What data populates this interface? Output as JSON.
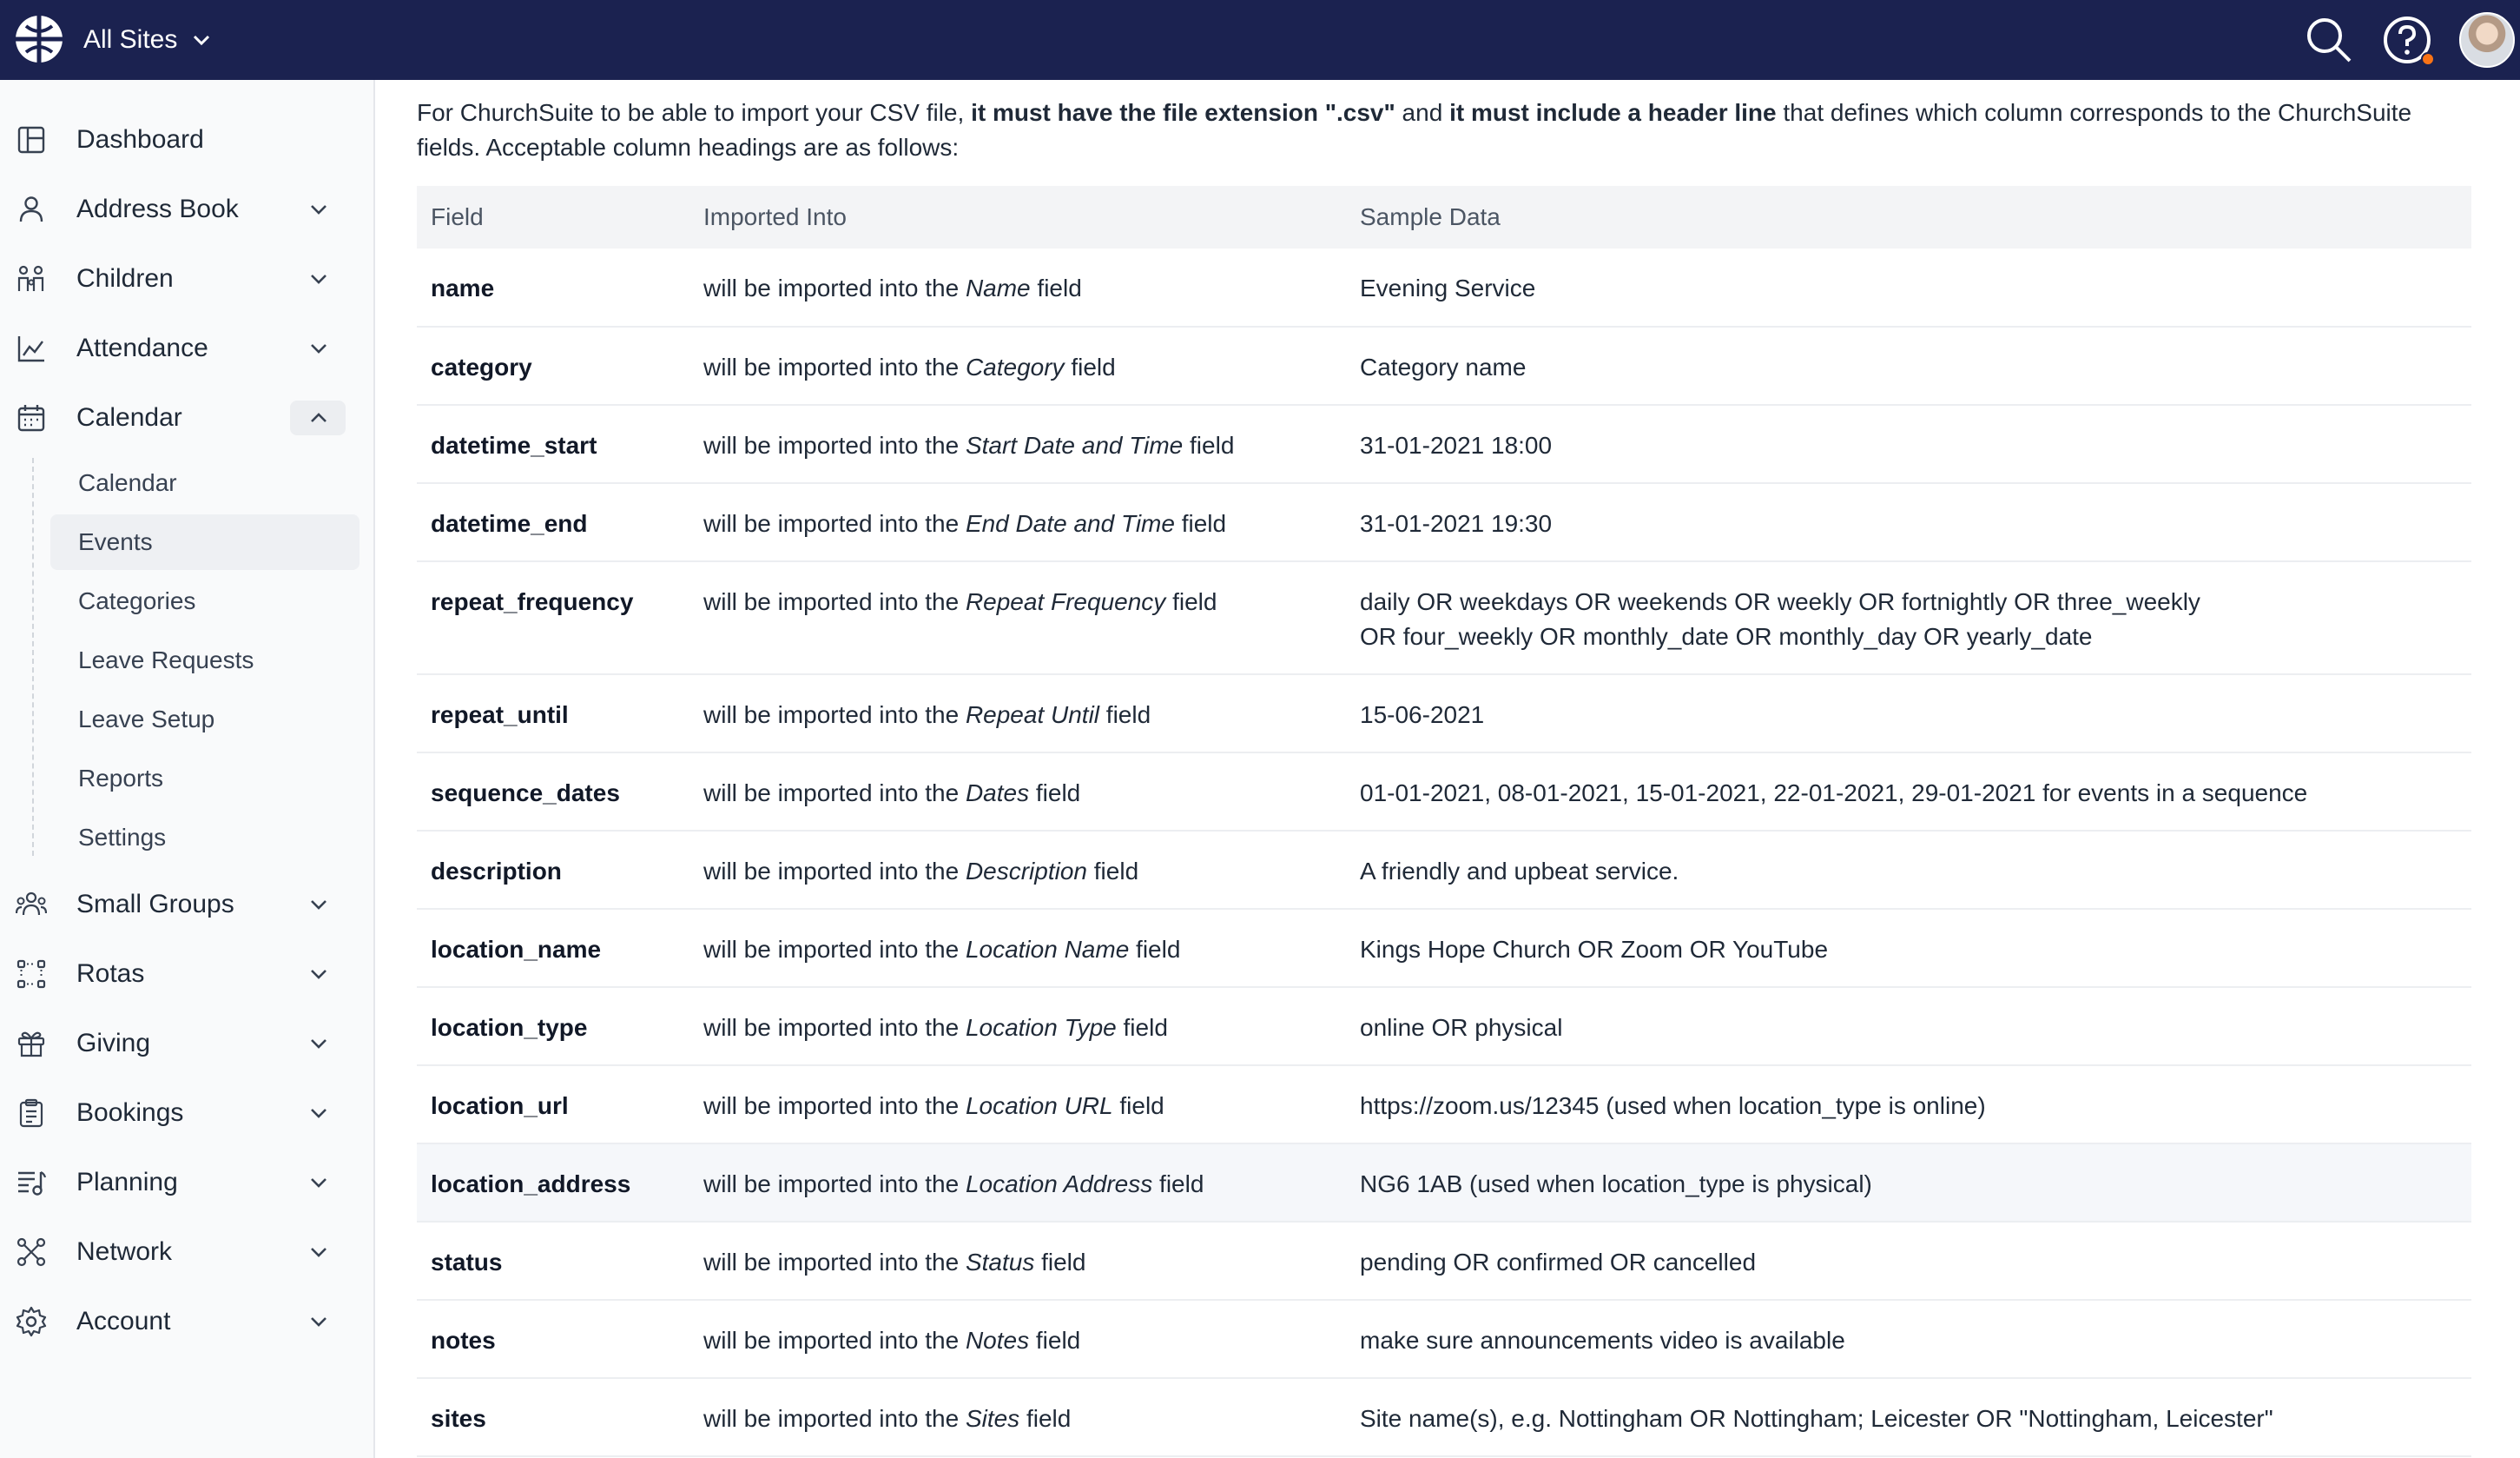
{
  "header": {
    "site_selector": "All Sites"
  },
  "sidebar": {
    "items": [
      {
        "label": "Dashboard",
        "icon": "dashboard-icon",
        "has_chevron": false
      },
      {
        "label": "Address Book",
        "icon": "person-icon",
        "has_chevron": true
      },
      {
        "label": "Children",
        "icon": "family-icon",
        "has_chevron": true
      },
      {
        "label": "Attendance",
        "icon": "chart-icon",
        "has_chevron": true
      },
      {
        "label": "Calendar",
        "icon": "calendar-icon",
        "has_chevron": true,
        "expanded": true
      },
      {
        "label": "Small Groups",
        "icon": "groups-icon",
        "has_chevron": true
      },
      {
        "label": "Rotas",
        "icon": "rotas-icon",
        "has_chevron": true
      },
      {
        "label": "Giving",
        "icon": "gift-icon",
        "has_chevron": true
      },
      {
        "label": "Bookings",
        "icon": "clipboard-icon",
        "has_chevron": true
      },
      {
        "label": "Planning",
        "icon": "planning-icon",
        "has_chevron": true
      },
      {
        "label": "Network",
        "icon": "network-icon",
        "has_chevron": true
      },
      {
        "label": "Account",
        "icon": "gear-icon",
        "has_chevron": true
      }
    ],
    "calendar_sub": [
      "Calendar",
      "Events",
      "Categories",
      "Leave Requests",
      "Leave Setup",
      "Reports",
      "Settings"
    ],
    "active_sub": "Events"
  },
  "intro": {
    "part1": "For ChurchSuite to be able to import your CSV file, ",
    "bold1": "it must have the file extension \".csv\"",
    "part2": " and ",
    "bold2": "it must include a header line",
    "part3": " that defines which column corresponds to the ChurchSuite fields. Acceptable column headings are as follows:"
  },
  "table": {
    "headers": [
      "Field",
      "Imported Into",
      "Sample Data"
    ],
    "prefix": "will be imported into the ",
    "suffix": " field",
    "rows": [
      {
        "field": "name",
        "target": "Name",
        "sample": [
          "Evening Service"
        ]
      },
      {
        "field": "category",
        "target": "Category",
        "sample": [
          "Category name"
        ]
      },
      {
        "field": "datetime_start",
        "target": "Start Date and Time",
        "sample": [
          "31-01-2021 18:00"
        ]
      },
      {
        "field": "datetime_end",
        "target": "End Date and Time",
        "sample": [
          "31-01-2021 19:30"
        ]
      },
      {
        "field": "repeat_frequency",
        "target": "Repeat Frequency",
        "sample": [
          "daily OR weekdays OR weekends OR weekly OR fortnightly OR three_weekly",
          "OR four_weekly OR monthly_date OR monthly_day OR yearly_date"
        ]
      },
      {
        "field": "repeat_until",
        "target": "Repeat Until",
        "sample": [
          "15-06-2021"
        ]
      },
      {
        "field": "sequence_dates",
        "target": "Dates",
        "sample": [
          "01-01-2021, 08-01-2021, 15-01-2021, 22-01-2021, 29-01-2021 for events in a sequence"
        ]
      },
      {
        "field": "description",
        "target": "Description",
        "sample": [
          "A friendly and upbeat service."
        ]
      },
      {
        "field": "location_name",
        "target": "Location Name",
        "sample": [
          "Kings Hope Church OR Zoom OR YouTube"
        ]
      },
      {
        "field": "location_type",
        "target": "Location Type",
        "sample": [
          "online OR physical"
        ]
      },
      {
        "field": "location_url",
        "target": "Location URL",
        "sample": [
          "https://zoom.us/12345 (used when location_type is online)"
        ]
      },
      {
        "field": "location_address",
        "target": "Location Address",
        "sample": [
          "NG6 1AB (used when location_type is physical)"
        ],
        "highlighted": true
      },
      {
        "field": "status",
        "target": "Status",
        "sample": [
          "pending OR confirmed OR cancelled"
        ]
      },
      {
        "field": "notes",
        "target": "Notes",
        "sample": [
          "make sure announcements video is available"
        ]
      },
      {
        "field": "sites",
        "target": "Sites",
        "sample": [
          "Site name(s), e.g. Nottingham OR Nottingham; Leicester OR \"Nottingham, Leicester\""
        ]
      }
    ]
  }
}
